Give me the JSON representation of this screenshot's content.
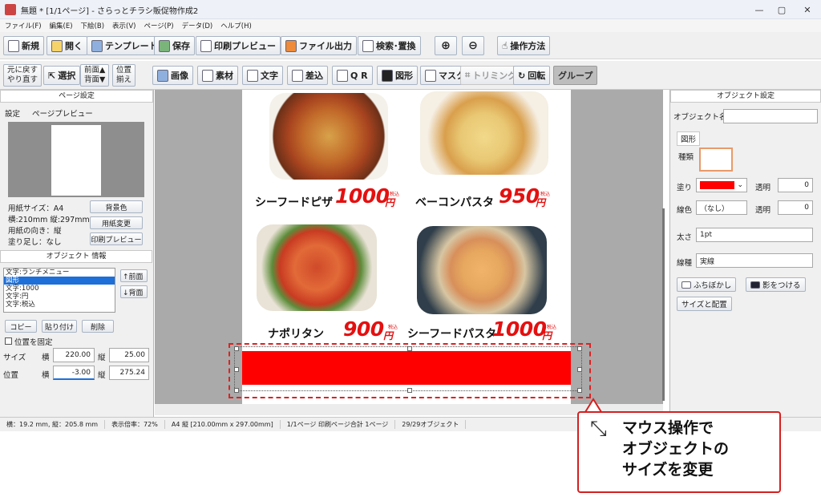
{
  "window": {
    "title": "無題 * [1/1ページ] - さらっとチラシ販促物作成2",
    "minimize": "—",
    "maximize": "▢",
    "close": "✕"
  },
  "menu": [
    "ファイル(F)",
    "編集(E)",
    "下絵(B)",
    "表示(V)",
    "ページ(P)",
    "データ(D)",
    "ヘルプ(H)"
  ],
  "toolbar1": {
    "new": "新規",
    "open": "開く",
    "template": "テンプレート",
    "save": "保存",
    "print_preview": "印刷プレビュー",
    "file_output": "ファイル出力",
    "search": "検索･置換",
    "help": "操作方法"
  },
  "toolbar2": {
    "undo": "元に戻す",
    "redo": "やり直す",
    "select": "選択",
    "front": "前面▲",
    "back": "背面▼",
    "align1": "位置",
    "align2": "揃え",
    "image": "画像",
    "material": "素材",
    "text": "文字",
    "merge": "差込",
    "qr": "Q R",
    "shape": "図形",
    "mask": "マスク",
    "trim": "トリミング",
    "rotate": "回転",
    "group": "グループ"
  },
  "page_settings": {
    "header": "ページ設定",
    "tab_settings": "設定",
    "tab_preview": "ページプレビュー",
    "paper_size": "用紙サイズ：A4",
    "dims": "横:210mm 縦:297mm",
    "orientation": "用紙の向き：縦",
    "bleed": "塗り足し：なし",
    "bg_color": "背景色",
    "change_paper": "用紙変更",
    "print_preview": "印刷プレビュー"
  },
  "object_info": {
    "header": "オブジェクト 情報",
    "items": [
      "文字:ランチメニュー",
      "図形",
      "文字:1000",
      "文字:円",
      "文字:税込"
    ],
    "selected": 1,
    "front": "↑前面",
    "back": "↓背面",
    "copy": "コピー",
    "paste": "貼り付け",
    "delete": "削除",
    "lock": "位置を固定",
    "size_label": "サイズ",
    "pos_label": "位置",
    "w_label": "横",
    "h_label": "縦",
    "size_w": "220.00",
    "size_h": "25.00",
    "pos_x": "-3.00",
    "pos_y": "275.24"
  },
  "flyer": {
    "dishes": [
      {
        "name": "シーフードピザ",
        "price": "1000",
        "yen": "円",
        "tax": "税込"
      },
      {
        "name": "ベーコンパスタ",
        "price": "950",
        "yen": "円",
        "tax": "税込"
      },
      {
        "name": "ナポリタン",
        "price": "900",
        "yen": "円",
        "tax": "税込"
      },
      {
        "name": "シーフードパスタ",
        "price": "1000",
        "yen": "円",
        "tax": "税込"
      }
    ]
  },
  "object_settings": {
    "header": "オブジェクト設定",
    "name_label": "オブジェクト名",
    "tab": "図形",
    "kind_label": "種類",
    "fill_label": "塗り",
    "fill_color": "#ff0000",
    "opacity_label": "透明",
    "opacity_fill": "0",
    "line_color_label": "線色",
    "line_color": "（なし）",
    "opacity_line": "0",
    "width_label": "太さ",
    "width_value": "1pt",
    "style_label": "線種",
    "style_value": "実線",
    "blur": "ふちぼかし",
    "shadow": "影をつける",
    "size_pos": "サイズと配置"
  },
  "status": {
    "cursor": "横：19.2 mm, 縦：205.8 mm",
    "zoom": "表示倍率：72%",
    "paper": "A4 縦 [210.00mm x 297.00mm]",
    "pages": "1/1ページ 印刷ページ合計 1ページ",
    "objects": "29/29オブジェクト"
  },
  "callout": {
    "line1": "マウス操作で",
    "line2": "オブジェクトの",
    "line3": "サイズを変更"
  }
}
